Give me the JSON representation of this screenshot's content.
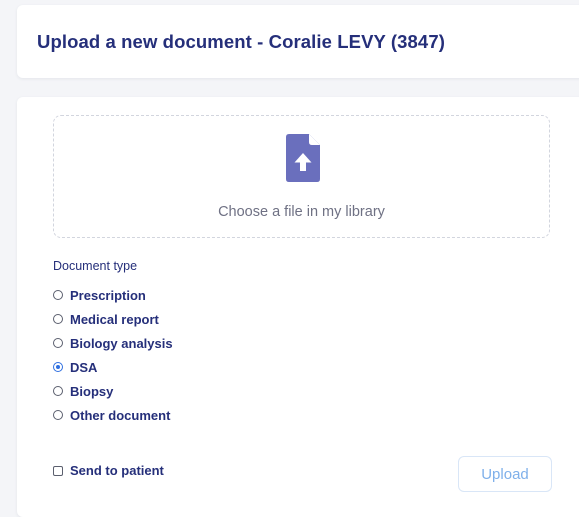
{
  "header": {
    "title": "Upload a new document - Coralie LEVY (3847)"
  },
  "dropzone": {
    "icon": "file-upload-icon",
    "label": "Choose a file in my library"
  },
  "document_type": {
    "label": "Document type",
    "options": [
      {
        "label": "Prescription",
        "checked": false
      },
      {
        "label": "Medical report",
        "checked": false
      },
      {
        "label": "Biology analysis",
        "checked": false
      },
      {
        "label": "DSA",
        "checked": true
      },
      {
        "label": "Biopsy",
        "checked": false
      },
      {
        "label": "Other document",
        "checked": false
      }
    ]
  },
  "send_to_patient": {
    "label": "Send to patient",
    "checked": false
  },
  "actions": {
    "upload_label": "Upload"
  },
  "colors": {
    "title": "#252f7a",
    "icon": "#6a6fbd",
    "radio_checked": "#2f6fe0",
    "upload_button_text": "#7fb0ea",
    "background": "#f4f5f8"
  }
}
